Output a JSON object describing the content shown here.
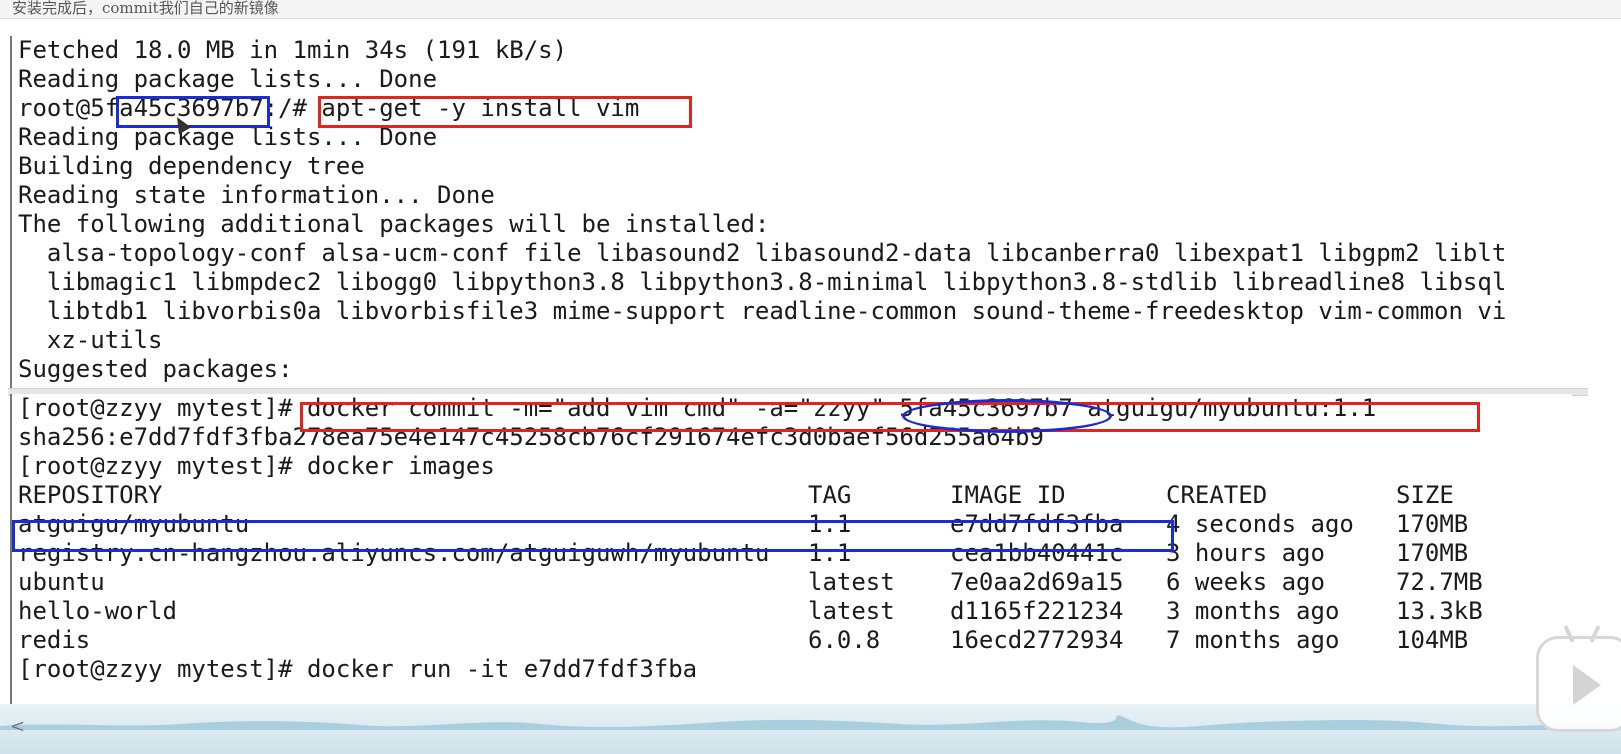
{
  "caption": "安装完成后，commit我们自己的新镜像",
  "top_terminal": {
    "lines": [
      "Fetched 18.0 MB in 1min 34s (191 kB/s)",
      "Reading package lists... Done",
      "root@5fa45c3697b7:/# apt-get -y install vim",
      "Reading package lists... Done",
      "Building dependency tree",
      "Reading state information... Done",
      "The following additional packages will be installed:",
      "  alsa-topology-conf alsa-ucm-conf file libasound2 libasound2-data libcanberra0 libexpat1 libgpm2 liblt",
      "  libmagic1 libmpdec2 libogg0 libpython3.8 libpython3.8-minimal libpython3.8-stdlib libreadline8 libsql",
      "  libtdb1 libvorbis0a libvorbisfile3 mime-support readline-common sound-theme-freedesktop vim-common vi",
      "  xz-utils",
      "Suggested packages:"
    ]
  },
  "bottom_terminal": {
    "commit_line": "[root@zzyy mytest]# docker commit -m=\"add vim cmd\" -a=\"zzyy\" 5fa45c3697b7 atguigu/myubuntu:1.1",
    "sha_line": "sha256:e7dd7fdf3fba278ea75e4e147c45258cb76cf291674efc3d0baef56d255a64b9",
    "images_cmd": "[root@zzyy mytest]# docker images",
    "table": {
      "headers": [
        "REPOSITORY",
        "TAG",
        "IMAGE ID",
        "CREATED",
        "SIZE"
      ],
      "rows": [
        [
          "atguigu/myubuntu",
          "1.1",
          "e7dd7fdf3fba",
          "4 seconds ago",
          "170MB"
        ],
        [
          "registry.cn-hangzhou.aliyuncs.com/atguiguwh/myubuntu",
          "1.1",
          "cea1bb40441c",
          "3 hours ago",
          "170MB"
        ],
        [
          "ubuntu",
          "latest",
          "7e0aa2d69a15",
          "6 weeks ago",
          "72.7MB"
        ],
        [
          "hello-world",
          "latest",
          "d1165f221234",
          "3 months ago",
          "13.3kB"
        ],
        [
          "redis",
          "6.0.8",
          "16ecd2772934",
          "7 months ago",
          "104MB"
        ]
      ]
    },
    "run_cmd": "[root@zzyy mytest]# docker run -it e7dd7fdf3fba"
  },
  "colors": {
    "annotation_red": "#e0261c",
    "annotation_blue": "#1a2bd8"
  },
  "icons": {
    "play": "play-icon",
    "scroll_left": "chevron-left-icon"
  },
  "scroll_left_glyph": "<"
}
